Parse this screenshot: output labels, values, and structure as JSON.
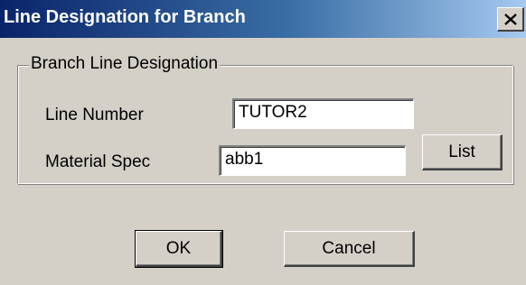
{
  "window": {
    "title": "Line Designation for Branch",
    "close_icon": "close-icon"
  },
  "group": {
    "legend": "Branch Line Designation"
  },
  "fields": {
    "line_number": {
      "label": "Line Number",
      "value": "TUTOR2"
    },
    "material_spec": {
      "label": "Material Spec",
      "value": "abb1"
    }
  },
  "buttons": {
    "list": "List",
    "ok": "OK",
    "cancel": "Cancel"
  },
  "colors": {
    "titlebar_start": "#0a246a",
    "titlebar_end": "#a6caf0",
    "face": "#d4d0c8"
  }
}
